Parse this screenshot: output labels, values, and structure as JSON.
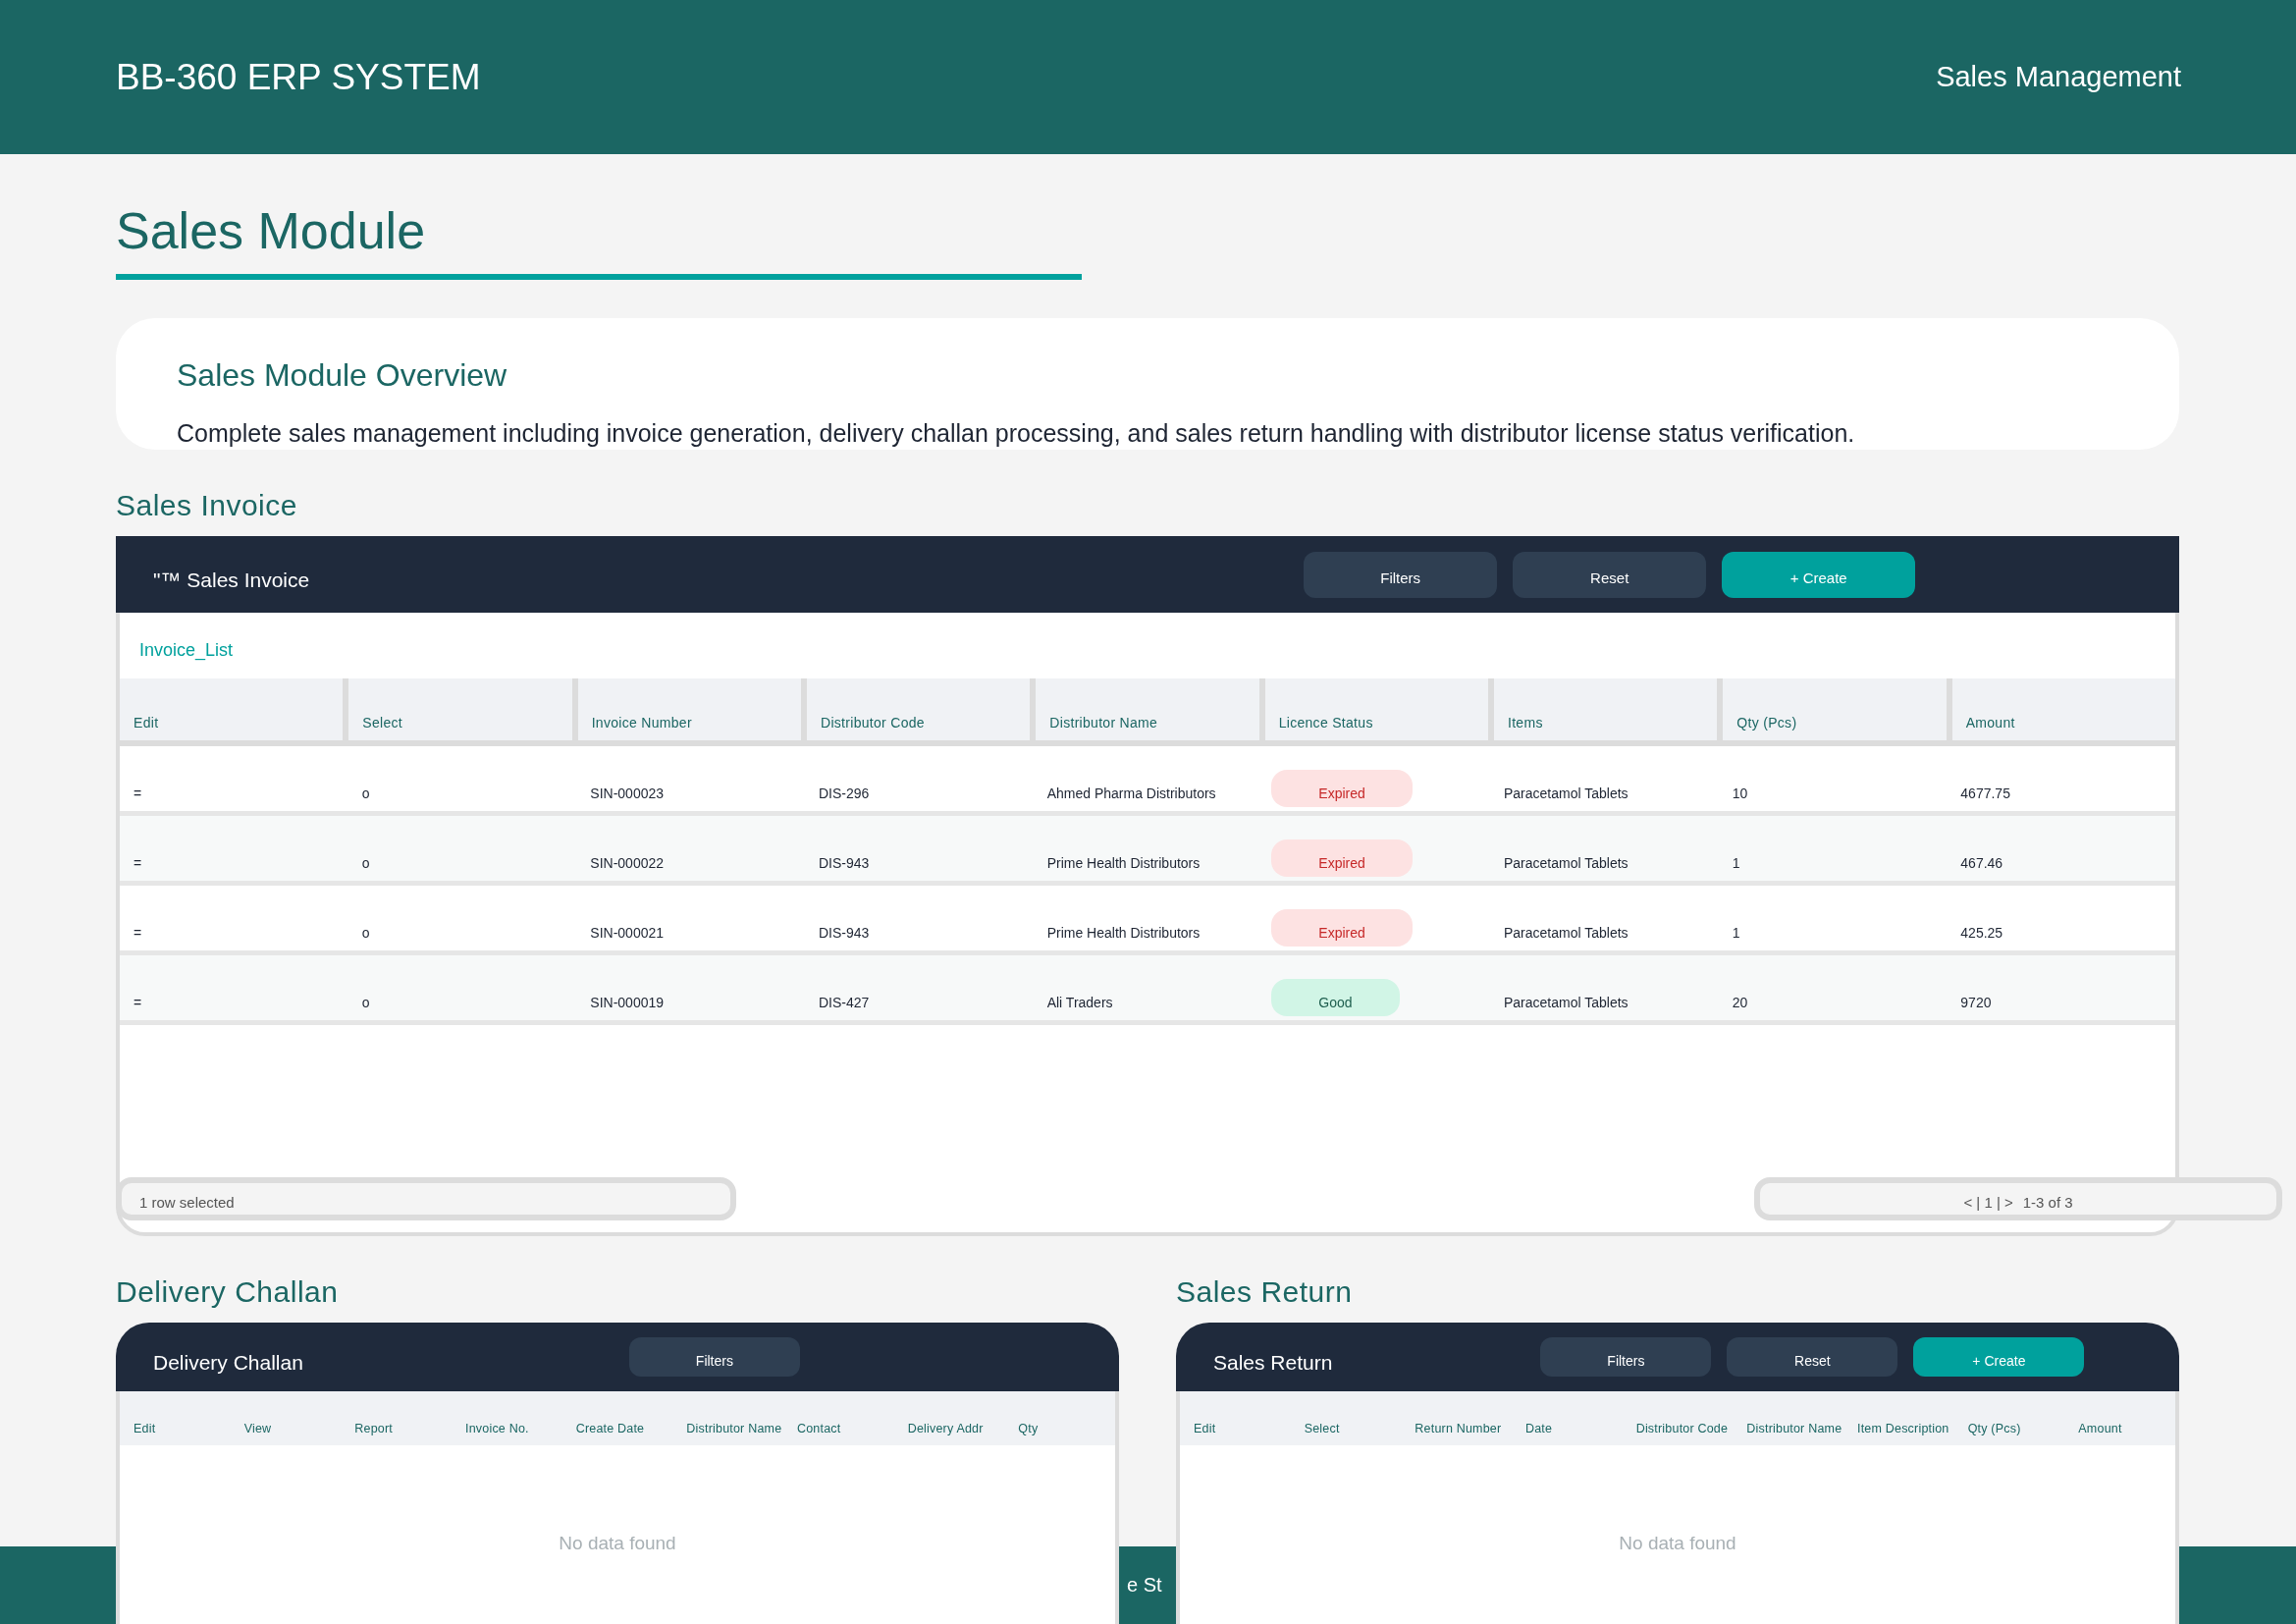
{
  "app_bar": {
    "title": "BB-360 ERP SYSTEM",
    "section": "Sales Management"
  },
  "page_title": "Sales Module",
  "overview": {
    "title": "Sales Module Overview",
    "text": "Complete sales management including invoice generation, delivery challan processing, and sales return handling with distributor license status verification."
  },
  "sales_invoice": {
    "section_label": "Sales Invoice",
    "card_title": "\"™ Sales Invoice",
    "buttons": [
      {
        "label": "Filters",
        "kind": "secondary"
      },
      {
        "label": "Reset",
        "kind": "secondary"
      },
      {
        "label": "+ Create",
        "kind": "primary"
      }
    ],
    "list_title": "Invoice_List",
    "columns": [
      "Edit",
      "Select",
      "Invoice Number",
      "Distributor Code",
      "Distributor Name",
      "Licence Status",
      "Items",
      "Qty (Pcs)",
      "Amount"
    ],
    "rows": [
      {
        "edit": "=",
        "select": "o",
        "invoice_number": "SIN-000023",
        "distributor_code": "DIS-296",
        "distributor_name": "Ahmed Pharma Distributors",
        "licence_status": {
          "label": "Expired",
          "kind": "expired"
        },
        "items": "Paracetamol Tablets",
        "qty": "10",
        "amount": "4677.75"
      },
      {
        "edit": "=",
        "select": "o",
        "invoice_number": "SIN-000022",
        "distributor_code": "DIS-943",
        "distributor_name": "Prime Health Distributors",
        "licence_status": {
          "label": "Expired",
          "kind": "expired"
        },
        "items": "Paracetamol Tablets",
        "qty": "1",
        "amount": "467.46"
      },
      {
        "edit": "=",
        "select": "o",
        "invoice_number": "SIN-000021",
        "distributor_code": "DIS-943",
        "distributor_name": "Prime Health Distributors",
        "licence_status": {
          "label": "Expired",
          "kind": "expired"
        },
        "items": "Paracetamol Tablets",
        "qty": "1",
        "amount": "425.25"
      },
      {
        "edit": "=",
        "select": "o",
        "invoice_number": "SIN-000019",
        "distributor_code": "DIS-427",
        "distributor_name": "Ali Traders",
        "licence_status": {
          "label": "Good",
          "kind": "good"
        },
        "items": "Paracetamol Tablets",
        "qty": "20",
        "amount": "9720"
      }
    ],
    "selection_status": "1 row selected",
    "pager": "< | 1 | >",
    "range": "1-3 of 3"
  },
  "delivery_challan": {
    "section_label": "Delivery Challan",
    "card_title": "Delivery Challan",
    "buttons": [
      {
        "label": "Filters",
        "kind": "secondary"
      }
    ],
    "columns": [
      "Edit",
      "View",
      "Report",
      "Invoice No.",
      "Create Date",
      "Distributor Name",
      "Contact",
      "Delivery Addr",
      "Qty"
    ],
    "empty_text": "No data found"
  },
  "sales_return": {
    "section_label": "Sales Return",
    "card_title": "Sales Return",
    "buttons": [
      {
        "label": "Filters",
        "kind": "secondary"
      },
      {
        "label": "Reset",
        "kind": "secondary"
      },
      {
        "label": "+ Create",
        "kind": "primary"
      }
    ],
    "columns": [
      "Edit",
      "Select",
      "Return Number",
      "Date",
      "Distributor Code",
      "Distributor Name",
      "Item Description",
      "Qty (Pcs)",
      "Amount"
    ],
    "empty_text": "No data found"
  },
  "footer": {
    "text": "e St"
  }
}
